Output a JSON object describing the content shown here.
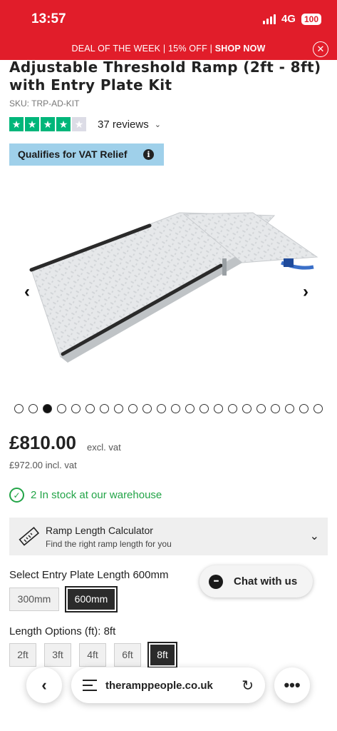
{
  "status_bar": {
    "time": "13:57",
    "network": "4G",
    "battery": "100"
  },
  "promo_bar": {
    "deal_text": "DEAL OF THE WEEK | 15% OFF | ",
    "cta": "SHOP NOW",
    "close_icon": "close-icon"
  },
  "product": {
    "title": "Adjustable Threshold Ramp (2ft - 8ft) with Entry Plate Kit",
    "sku": "SKU: TRP-AD-KIT",
    "rating": {
      "stars": 4,
      "max": 5,
      "reviews_label": "37 reviews",
      "star_color": "#00b67a"
    },
    "vat_badge": "Qualifies for VAT Relief",
    "image_alt_icon": "aluminium-ramp-image",
    "carousel": {
      "dot_count": 22,
      "active_index": 2
    },
    "price_excl": "£810.00",
    "price_excl_label": "excl. vat",
    "price_incl": "£972.00",
    "price_incl_label": "incl. vat",
    "stock_text": "2 In stock at our warehouse",
    "stock_color": "#22a447"
  },
  "calculator": {
    "title": "Ramp Length Calculator",
    "subtitle": "Find the right ramp length for you"
  },
  "entry_plate": {
    "label": "Select Entry Plate Length",
    "selected": "600mm",
    "options": [
      "300mm",
      "600mm"
    ]
  },
  "length": {
    "label": "Length Options (ft):",
    "selected": "8ft",
    "options": [
      "2ft",
      "3ft",
      "4ft",
      "6ft",
      "8ft"
    ]
  },
  "chat": {
    "label": "Chat with us"
  },
  "browser": {
    "url": "theramppeople.co.uk"
  },
  "accent_color": "#e11d2a"
}
